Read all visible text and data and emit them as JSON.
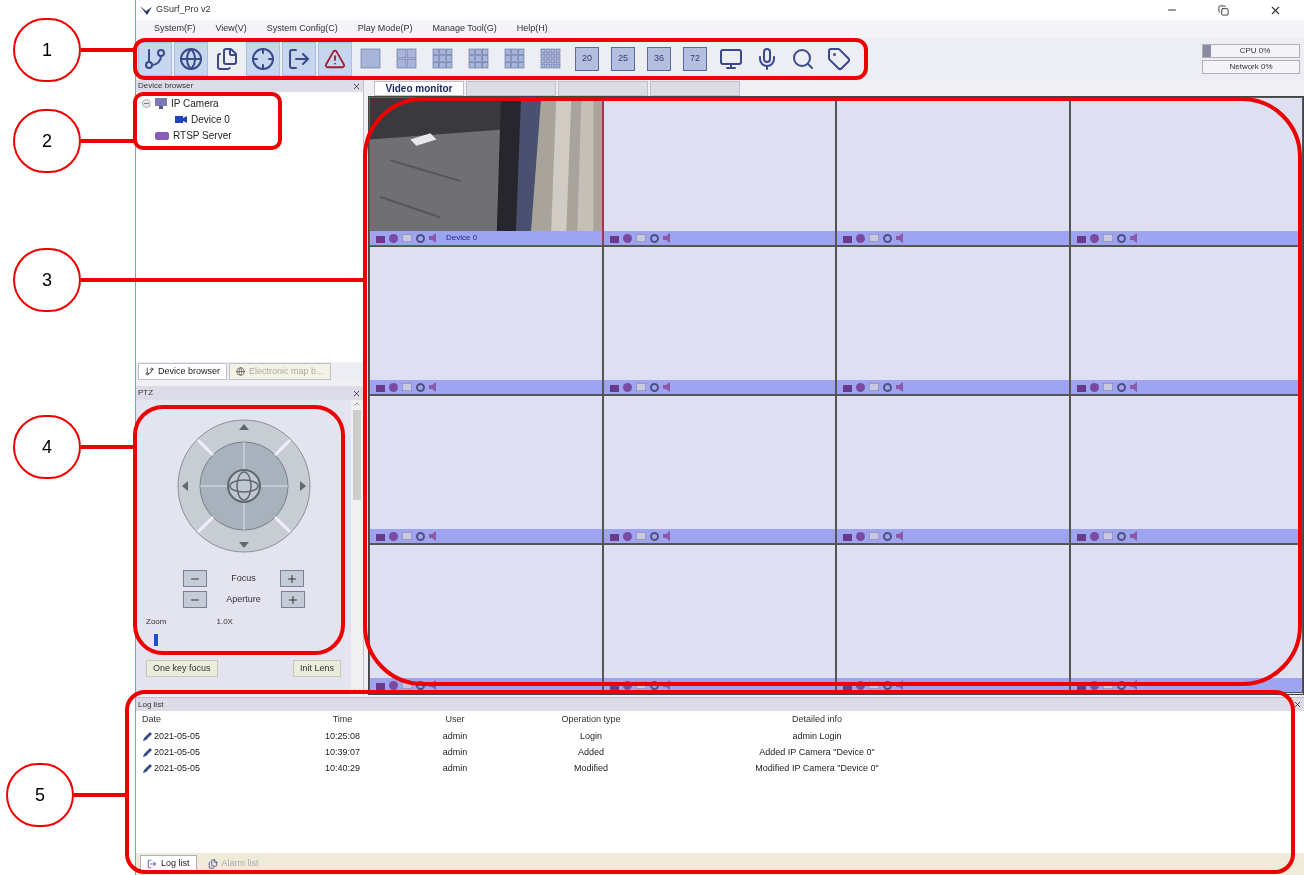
{
  "window": {
    "title": "GSurf_Pro v2"
  },
  "menu": [
    "System(F)",
    "View(V)",
    "System Config(C)",
    "Play Mode(P)",
    "Manage Tool(G)",
    "Help(H)"
  ],
  "toolbar": [
    {
      "kind": "branch",
      "on": true
    },
    {
      "kind": "globe",
      "on": true
    },
    {
      "kind": "pages",
      "on": false
    },
    {
      "kind": "target",
      "on": true
    },
    {
      "kind": "export",
      "on": true
    },
    {
      "kind": "alert",
      "on": true
    },
    {
      "kind": "grid1",
      "on": false
    },
    {
      "kind": "grid4",
      "on": false
    },
    {
      "kind": "grid6",
      "on": false
    },
    {
      "kind": "grid8",
      "on": false
    },
    {
      "kind": "grid9",
      "on": false
    },
    {
      "kind": "grid16",
      "on": false
    },
    {
      "kind": "numbered",
      "label": "20",
      "on": false
    },
    {
      "kind": "numbered",
      "label": "25",
      "on": false
    },
    {
      "kind": "numbered",
      "label": "36",
      "on": false
    },
    {
      "kind": "numbered",
      "label": "72",
      "on": false
    },
    {
      "kind": "monitor",
      "on": false
    },
    {
      "kind": "microphone",
      "on": false
    },
    {
      "kind": "search",
      "on": false
    },
    {
      "kind": "tag",
      "on": false
    }
  ],
  "status": {
    "cpu": "CPU 0%",
    "network": "Network 0%"
  },
  "device_browser": {
    "title": "Device browser",
    "tree": [
      {
        "label": "IP Camera",
        "kind": "camera",
        "expanded": true,
        "children": [
          {
            "label": "Device 0",
            "kind": "device"
          }
        ]
      },
      {
        "label": "RTSP Server",
        "kind": "server"
      }
    ],
    "tabs": [
      {
        "label": "Device browser",
        "selected": true
      },
      {
        "label": "Electronic map b...",
        "selected": false
      }
    ]
  },
  "ptz": {
    "title": "PTZ",
    "controls": [
      {
        "label": "Focus"
      },
      {
        "label": "Aperture"
      }
    ],
    "zoom_label": "Zoom",
    "zoom_value": "1.0X",
    "zoom": {
      "level": 0.02
    },
    "buttons": [
      "One key focus",
      "Init Lens"
    ]
  },
  "video_tabs": [
    {
      "label": "Video monitor",
      "selected": true
    },
    {
      "selected": false
    },
    {
      "selected": false
    },
    {
      "selected": false
    }
  ],
  "video_cells": [
    {
      "kind": "picture",
      "label": "Device 0",
      "selected": true
    },
    {
      "kind": "empty",
      "selected": false
    },
    {
      "kind": "empty",
      "selected": false
    },
    {
      "kind": "empty",
      "selected": false
    },
    {
      "kind": "empty",
      "selected": false
    },
    {
      "kind": "empty",
      "selected": false
    },
    {
      "kind": "empty",
      "selected": false
    },
    {
      "kind": "empty",
      "selected": false
    },
    {
      "kind": "empty",
      "selected": false
    },
    {
      "kind": "empty",
      "selected": false
    },
    {
      "kind": "empty",
      "selected": false
    },
    {
      "kind": "empty",
      "selected": false
    },
    {
      "kind": "empty",
      "selected": false
    },
    {
      "kind": "empty",
      "selected": false
    },
    {
      "kind": "empty",
      "selected": false
    },
    {
      "kind": "empty",
      "selected": false
    }
  ],
  "log": {
    "title": "Log list",
    "columns": [
      "Date",
      "Time",
      "User",
      "Operation type",
      "Detailed info"
    ],
    "rows": [
      [
        "2021-05-05",
        "10:25:08",
        "admin",
        "Login",
        "admin Login"
      ],
      [
        "2021-05-05",
        "10:39:07",
        "admin",
        "Added",
        "Added IP Camera \"Device 0\""
      ],
      [
        "2021-05-05",
        "10:40:29",
        "admin",
        "Modified",
        "Modified IP Camera \"Device 0\""
      ]
    ],
    "tabs": [
      {
        "label": "Log list",
        "selected": true
      },
      {
        "label": "Alarm list",
        "selected": false
      }
    ]
  },
  "callouts": [
    "1",
    "2",
    "3",
    "4",
    "5"
  ]
}
